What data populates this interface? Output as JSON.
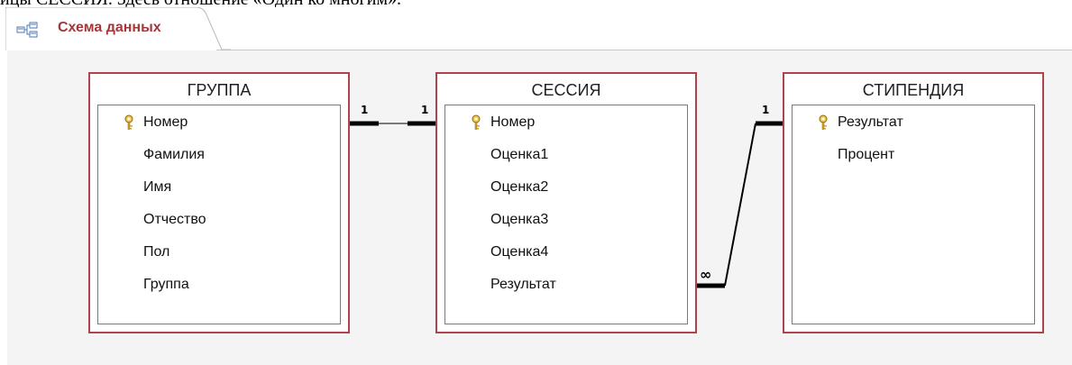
{
  "caption_fragment": "ицы СЕССИЯ. Здесь отношение «Один ко многим».",
  "tab": {
    "label": "Схема данных",
    "icon": "relationships-icon"
  },
  "colors": {
    "accent": "#a4373a",
    "table_border": "#b3424f",
    "canvas": "#f4f4f4"
  },
  "tables": [
    {
      "title": "ГРУППА",
      "fields": [
        "Номер",
        "Фамилия",
        "Имя",
        "Отчество",
        "Пол",
        "Группа"
      ],
      "key_field": "Номер"
    },
    {
      "title": "СЕССИЯ",
      "fields": [
        "Номер",
        "Оценка1",
        "Оценка2",
        "Оценка3",
        "Оценка4",
        "Результат"
      ],
      "key_field": "Номер"
    },
    {
      "title": "СТИПЕНДИЯ",
      "fields": [
        "Результат",
        "Процент"
      ],
      "key_field": "Результат"
    }
  ],
  "relationships": [
    {
      "from": "ГРУППА.Номер",
      "to": "СЕССИЯ.Номер",
      "from_label": "1",
      "to_label": "1"
    },
    {
      "from": "СЕССИЯ.Результат",
      "to": "СТИПЕНДИЯ.Результат",
      "from_label": "∞",
      "to_label": "1"
    }
  ]
}
